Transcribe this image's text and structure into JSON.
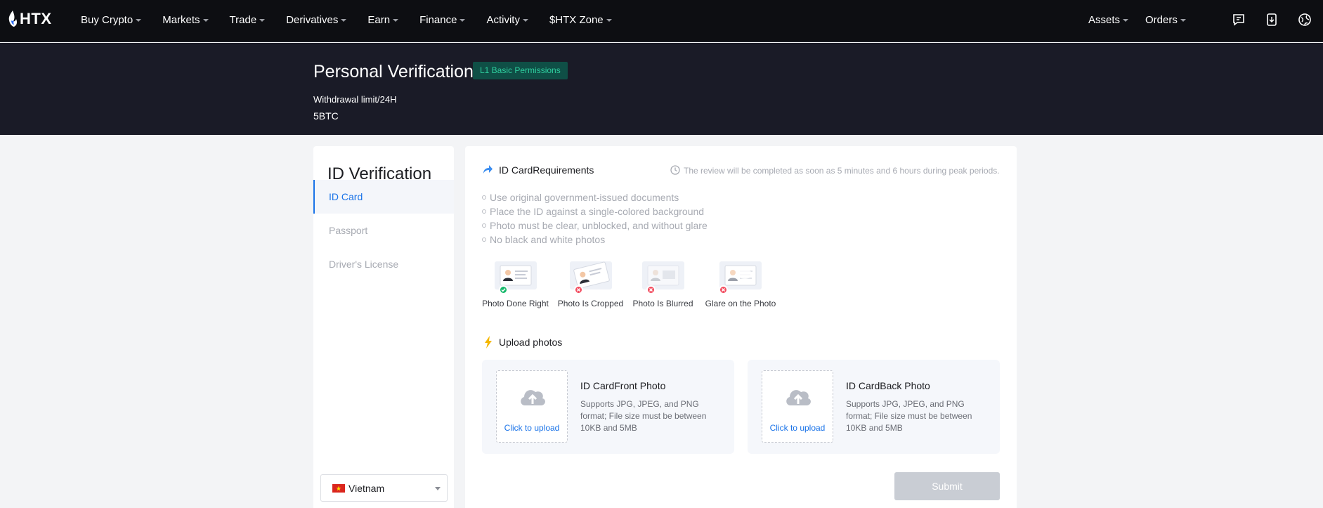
{
  "brand": {
    "name": "HTX"
  },
  "nav": {
    "items": [
      {
        "label": "Buy Crypto"
      },
      {
        "label": "Markets"
      },
      {
        "label": "Trade"
      },
      {
        "label": "Derivatives"
      },
      {
        "label": "Earn"
      },
      {
        "label": "Finance"
      },
      {
        "label": "Activity"
      },
      {
        "label": "$HTX Zone"
      }
    ],
    "right": [
      {
        "label": "Assets"
      },
      {
        "label": "Orders"
      }
    ],
    "icons": [
      "message-icon",
      "download-app-icon",
      "language-globe-icon"
    ]
  },
  "banner": {
    "title": "Personal Verification",
    "level_badge": "L1 Basic Permissions",
    "limit_label": "Withdrawal limit/24H",
    "limit_value": "5BTC"
  },
  "sidebar": {
    "title": "ID Verification",
    "doc_types": [
      {
        "label": "ID Card",
        "active": true
      },
      {
        "label": "Passport",
        "active": false
      },
      {
        "label": "Driver's License",
        "active": false
      }
    ],
    "country": "Vietnam"
  },
  "requirements": {
    "title": "ID CardRequirements",
    "review_note": "The review will be completed as soon as 5 minutes and 6 hours during peak periods.",
    "items": [
      "Use original government-issued documents",
      "Place the ID against a single-colored background",
      "Photo must be clear, unblocked, and without glare",
      "No black and white photos"
    ],
    "examples": [
      {
        "label": "Photo Done Right",
        "status": "ok"
      },
      {
        "label": "Photo Is Cropped",
        "status": "error"
      },
      {
        "label": "Photo Is Blurred",
        "status": "error"
      },
      {
        "label": "Glare on the Photo",
        "status": "error"
      }
    ]
  },
  "upload": {
    "title": "Upload photos",
    "click_label": "Click to upload",
    "cards": [
      {
        "name": "ID CardFront Photo",
        "desc": "Supports JPG, JPEG, and PNG format; File size must be between 10KB and 5MB"
      },
      {
        "name": "ID CardBack Photo",
        "desc": "Supports JPG, JPEG, and PNG format; File size must be between 10KB and 5MB"
      }
    ]
  },
  "submit_label": "Submit",
  "colors": {
    "accent": "#1a73e8",
    "ok": "#14b86a",
    "error": "#f24b5e",
    "badge_text": "#2fcf9f"
  }
}
